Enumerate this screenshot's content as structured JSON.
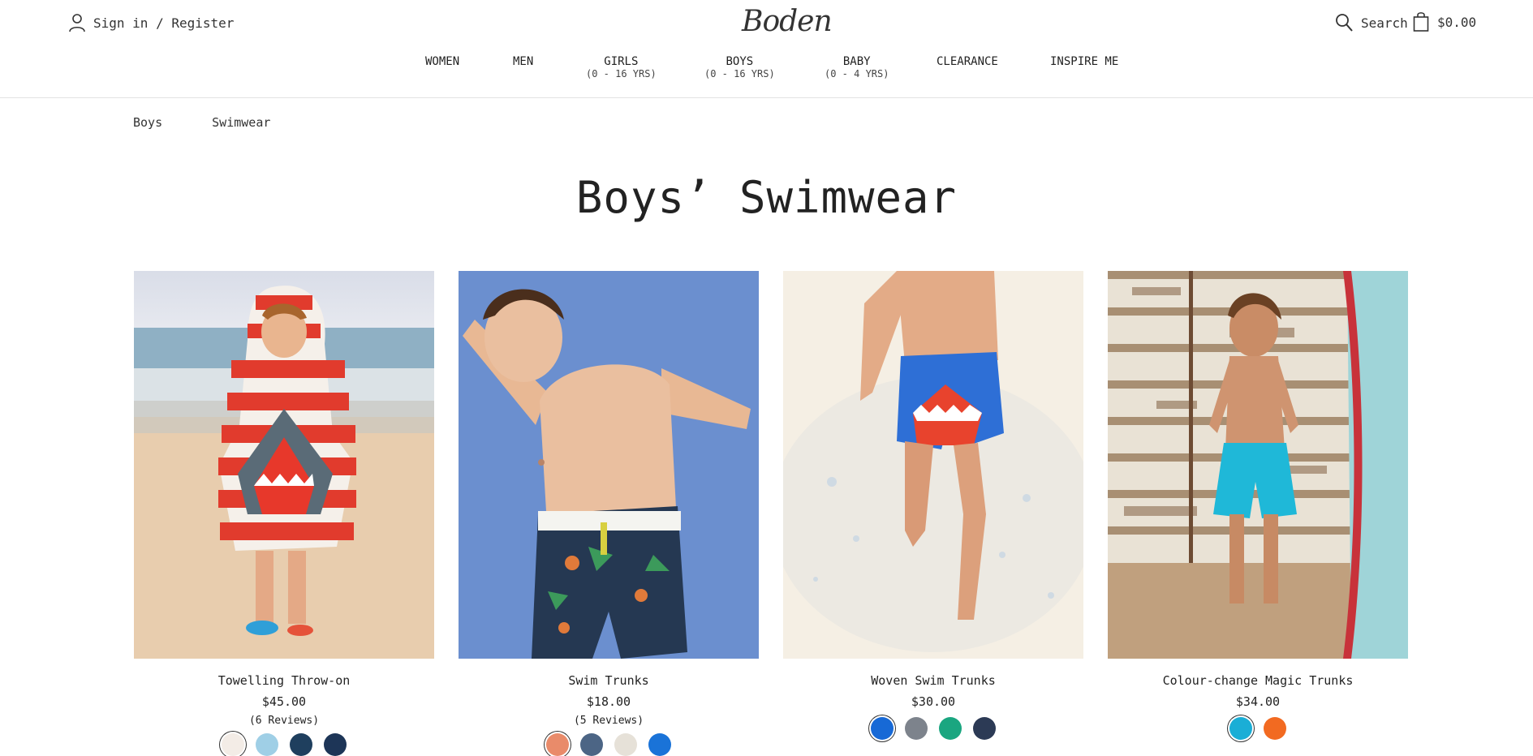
{
  "header": {
    "signin_label": "Sign in / Register",
    "logo_text": "Boden",
    "search_label": "Search",
    "bag_total": "$0.00"
  },
  "nav": [
    {
      "label": "WOMEN",
      "sub": ""
    },
    {
      "label": "MEN",
      "sub": ""
    },
    {
      "label": "GIRLS",
      "sub": "(0 - 16 YRS)"
    },
    {
      "label": "BOYS",
      "sub": "(0 - 16 YRS)"
    },
    {
      "label": "BABY",
      "sub": "(0 - 4 YRS)"
    },
    {
      "label": "CLEARANCE",
      "sub": ""
    },
    {
      "label": "INSPIRE ME",
      "sub": ""
    }
  ],
  "breadcrumb": [
    "Boys",
    "Swimwear"
  ],
  "page_title": "Boys’ Swimwear",
  "products": [
    {
      "name": "Towelling Throw-on",
      "price": "$45.00",
      "reviews": "(6 Reviews)",
      "swatches": [
        "#f3ece6",
        "#9fcfe6",
        "#1f3f5e",
        "#1d3557"
      ]
    },
    {
      "name": "Swim Trunks",
      "price": "$18.00",
      "reviews": "(5 Reviews)",
      "swatches": [
        "#e98b6a",
        "#4c6585",
        "#e6e1d8",
        "#1a73d8"
      ]
    },
    {
      "name": "Woven Swim Trunks",
      "price": "$30.00",
      "reviews": "",
      "swatches": [
        "#1769d6",
        "#7d838c",
        "#1aa680",
        "#2c3a55"
      ]
    },
    {
      "name": "Colour-change Magic Trunks",
      "price": "$34.00",
      "reviews": "",
      "swatches": [
        "#1aaed6",
        "#f26a21"
      ]
    }
  ]
}
